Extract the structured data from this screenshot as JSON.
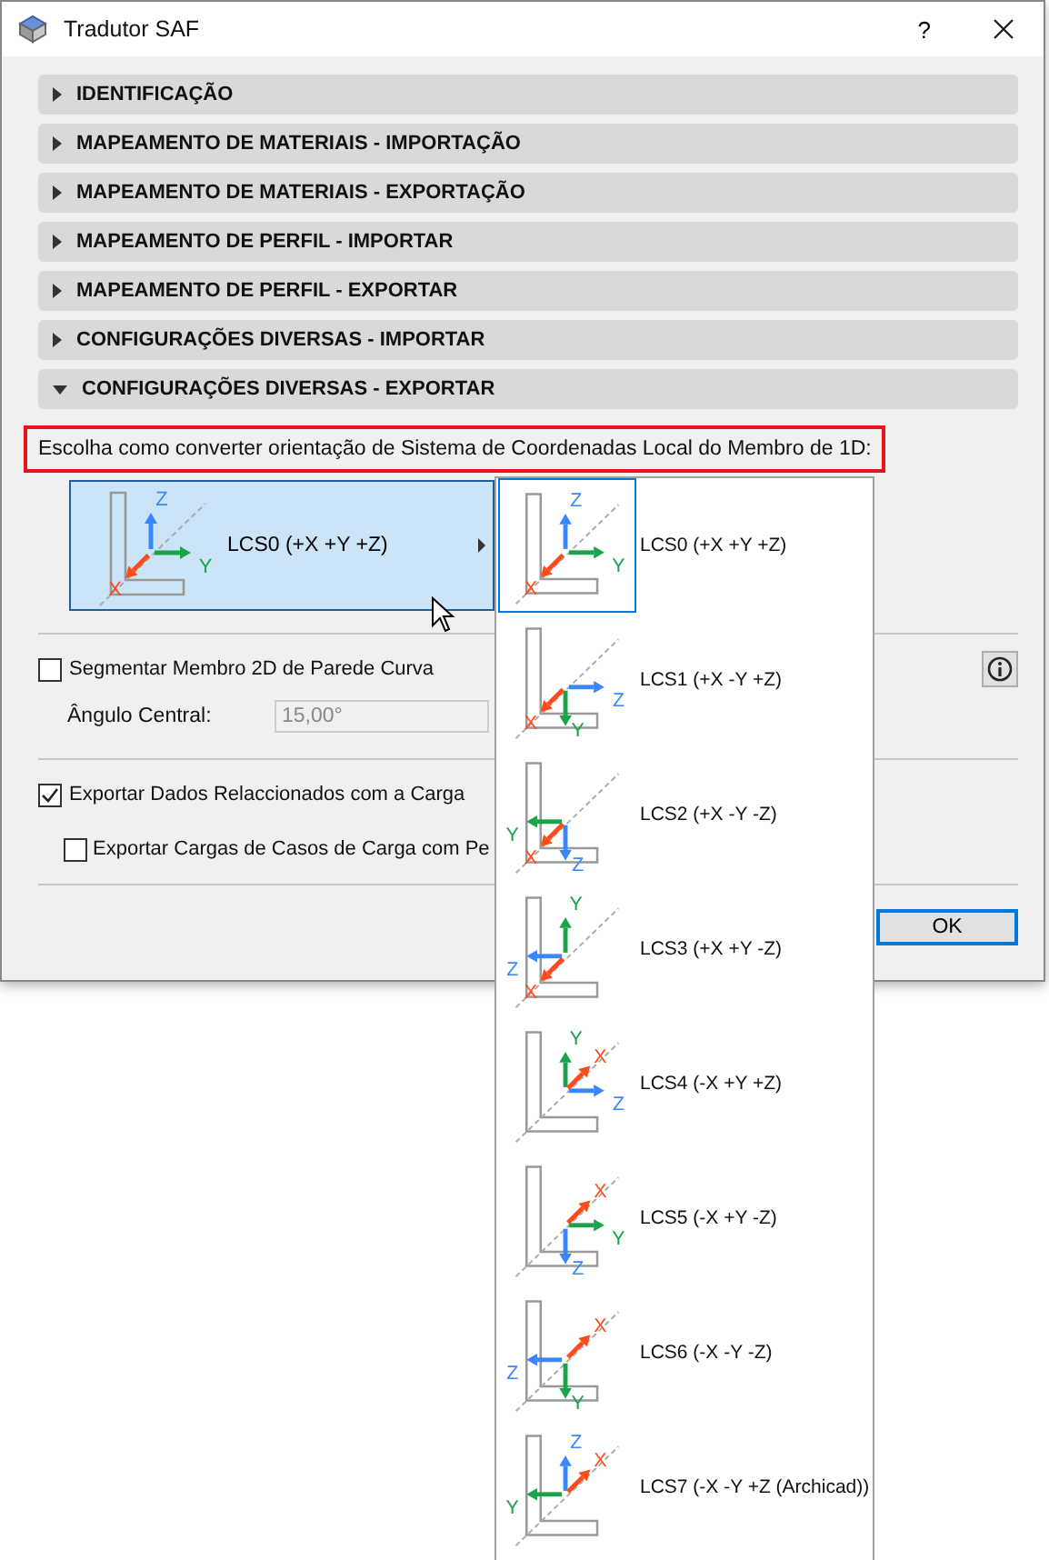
{
  "window": {
    "title": "Tradutor SAF",
    "help": "?"
  },
  "sections": [
    {
      "title": "IDENTIFICAÇÃO",
      "expanded": false
    },
    {
      "title": "MAPEAMENTO DE MATERIAIS - IMPORTAÇÃO",
      "expanded": false
    },
    {
      "title": "MAPEAMENTO DE MATERIAIS - EXPORTAÇÃO",
      "expanded": false
    },
    {
      "title": "MAPEAMENTO DE PERFIL - IMPORTAR",
      "expanded": false
    },
    {
      "title": "MAPEAMENTO DE PERFIL - EXPORTAR",
      "expanded": false
    },
    {
      "title": "CONFIGURAÇÕES DIVERSAS - IMPORTAR",
      "expanded": false
    },
    {
      "title": "CONFIGURAÇÕES DIVERSAS - EXPORTAR",
      "expanded": true
    }
  ],
  "prompt": "Escolha como converter orientação de Sistema de Coordenadas Local do Membro de 1D:",
  "dropdown": {
    "value": "LCS0 (+X +Y +Z)",
    "axes": [
      {
        "label": "Z",
        "kind": "up",
        "color": "#3a86ff"
      },
      {
        "label": "Y",
        "kind": "right",
        "color": "#1aa34a"
      },
      {
        "label": "X",
        "kind": "downleft",
        "color": "#ff4a1c"
      }
    ]
  },
  "options": [
    {
      "label": "LCS0 (+X +Y +Z)",
      "selected": true,
      "axes": [
        {
          "label": "Z",
          "kind": "up",
          "color": "#3a86ff"
        },
        {
          "label": "Y",
          "kind": "right",
          "color": "#1aa34a"
        },
        {
          "label": "X",
          "kind": "downleft",
          "color": "#ff4a1c"
        }
      ]
    },
    {
      "label": "LCS1 (+X -Y +Z)",
      "selected": false,
      "axes": [
        {
          "label": "Z",
          "kind": "right",
          "color": "#3a86ff"
        },
        {
          "label": "Y",
          "kind": "down",
          "color": "#1aa34a"
        },
        {
          "label": "X",
          "kind": "downleft",
          "color": "#ff4a1c"
        }
      ]
    },
    {
      "label": "LCS2 (+X -Y -Z)",
      "selected": false,
      "axes": [
        {
          "label": "Y",
          "kind": "left",
          "color": "#1aa34a"
        },
        {
          "label": "Z",
          "kind": "down",
          "color": "#3a86ff"
        },
        {
          "label": "X",
          "kind": "downleft",
          "color": "#ff4a1c"
        }
      ]
    },
    {
      "label": "LCS3 (+X +Y -Z)",
      "selected": false,
      "axes": [
        {
          "label": "Y",
          "kind": "up",
          "color": "#1aa34a"
        },
        {
          "label": "Z",
          "kind": "left",
          "color": "#3a86ff"
        },
        {
          "label": "X",
          "kind": "downleft",
          "color": "#ff4a1c"
        }
      ]
    },
    {
      "label": "LCS4 (-X +Y +Z)",
      "selected": false,
      "axes": [
        {
          "label": "Y",
          "kind": "up",
          "color": "#1aa34a"
        },
        {
          "label": "Z",
          "kind": "right",
          "color": "#3a86ff"
        },
        {
          "label": "X",
          "kind": "upright",
          "color": "#ff4a1c"
        }
      ]
    },
    {
      "label": "LCS5 (-X +Y -Z)",
      "selected": false,
      "axes": [
        {
          "label": "Y",
          "kind": "right",
          "color": "#1aa34a"
        },
        {
          "label": "Z",
          "kind": "down",
          "color": "#3a86ff"
        },
        {
          "label": "X",
          "kind": "upright",
          "color": "#ff4a1c"
        }
      ]
    },
    {
      "label": "LCS6 (-X -Y -Z)",
      "selected": false,
      "axes": [
        {
          "label": "Z",
          "kind": "left",
          "color": "#3a86ff"
        },
        {
          "label": "Y",
          "kind": "down",
          "color": "#1aa34a"
        },
        {
          "label": "X",
          "kind": "upright",
          "color": "#ff4a1c"
        }
      ]
    },
    {
      "label": "LCS7 (-X -Y +Z (Archicad))",
      "selected": false,
      "axes": [
        {
          "label": "Z",
          "kind": "up",
          "color": "#3a86ff"
        },
        {
          "label": "Y",
          "kind": "left",
          "color": "#1aa34a"
        },
        {
          "label": "X",
          "kind": "upright",
          "color": "#ff4a1c"
        }
      ]
    }
  ],
  "segment": {
    "label": "Segmentar Membro 2D de Parede Curva",
    "checked": false
  },
  "angle": {
    "label": "Ângulo Central:",
    "value": "15,00°",
    "disabled": true
  },
  "export_loads": {
    "label": "Exportar Dados Relaccionados com a Carga",
    "checked": true
  },
  "export_cases": {
    "label": "Exportar Cargas de Casos de Carga com Pe",
    "checked": false
  },
  "buttons": [
    "OK"
  ]
}
